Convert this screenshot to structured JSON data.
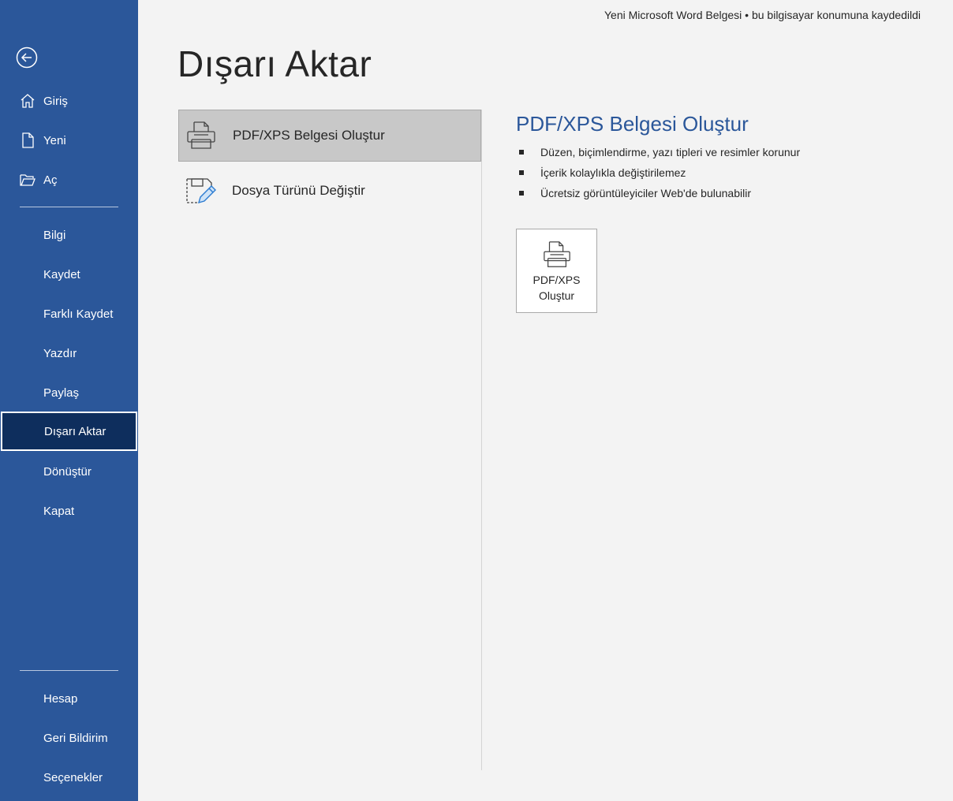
{
  "header": {
    "doc_status": "Yeni Microsoft Word Belgesi • bu bilgisayar konumuna kaydedildi",
    "page_title": "Dışarı Aktar"
  },
  "sidebar": {
    "back_icon": "back-arrow-icon",
    "top_items": [
      {
        "label": "Giriş",
        "icon": "home-icon"
      },
      {
        "label": "Yeni",
        "icon": "new-document-icon"
      },
      {
        "label": "Aç",
        "icon": "open-folder-icon"
      }
    ],
    "items": [
      {
        "label": "Bilgi"
      },
      {
        "label": "Kaydet"
      },
      {
        "label": "Farklı Kaydet"
      },
      {
        "label": "Yazdır"
      },
      {
        "label": "Paylaş"
      },
      {
        "label": "Dışarı Aktar",
        "selected": true
      },
      {
        "label": "Dönüştür"
      },
      {
        "label": "Kapat"
      }
    ],
    "bottom_items": [
      {
        "label": "Hesap"
      },
      {
        "label": "Geri Bildirim"
      },
      {
        "label": "Seçenekler"
      }
    ],
    "colors": {
      "background": "#2b579a",
      "selected": "#0e2e5d"
    }
  },
  "options": [
    {
      "label": "PDF/XPS Belgesi Oluştur",
      "icon": "pdf-xps-icon",
      "selected": true
    },
    {
      "label": "Dosya Türünü Değiştir",
      "icon": "change-file-type-icon",
      "selected": false
    }
  ],
  "detail": {
    "title": "PDF/XPS Belgesi Oluştur",
    "bullets": [
      "Düzen, biçimlendirme, yazı tipleri ve resimler korunur",
      "İçerik kolaylıkla değiştirilemez",
      "Ücretsiz görüntüleyiciler Web'de bulunabilir"
    ],
    "button_label": "PDF/XPS\nOluştur",
    "button_icon": "pdf-xps-icon",
    "title_color": "#2b579a"
  }
}
